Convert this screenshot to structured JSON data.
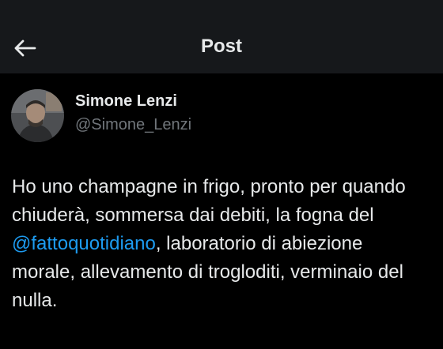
{
  "header": {
    "back_icon": "arrow-left-icon",
    "title": "Post"
  },
  "author": {
    "display_name": "Simone Lenzi",
    "handle": "@Simone_Lenzi"
  },
  "post": {
    "line1": "Ho uno champagne in frigo, pronto per quando",
    "line2": "chiuderà, sommersa dai debiti, la fogna del",
    "mention": "@fattoquotidiano",
    "line3_rest": ", laboratorio di abiezione",
    "line4": "morale, allevamento di trogloditi, verminaio del",
    "line5": "nulla."
  },
  "colors": {
    "background": "#000000",
    "header_background": "#16181b",
    "text": "#e7e9ea",
    "secondary_text": "#71767b",
    "link": "#1d9bf0"
  }
}
